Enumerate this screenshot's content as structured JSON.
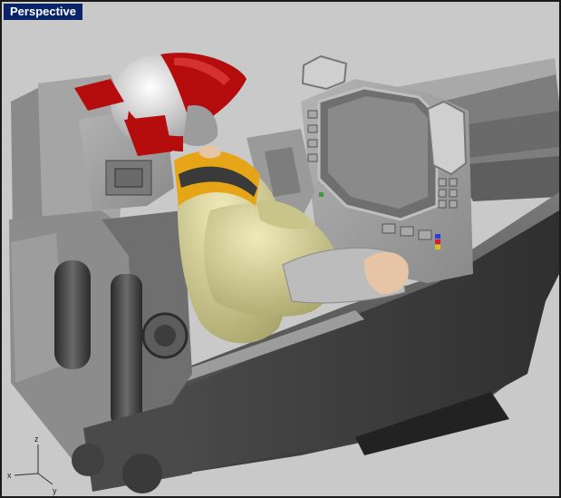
{
  "viewport": {
    "title": "Perspective",
    "background_color": "#c9c9c9",
    "title_bg_color": "#0a246a",
    "title_text_color": "#ffffff"
  },
  "scene": {
    "axes": {
      "x": "x",
      "y": "y",
      "z": "z"
    },
    "colors": {
      "helmet_red": "#b50d0d",
      "helmet_white": "#e8e8e8",
      "flight_suit": "#dcd896",
      "life_vest": "#e5a516",
      "cockpit_gray": "#8f8f8f"
    }
  }
}
